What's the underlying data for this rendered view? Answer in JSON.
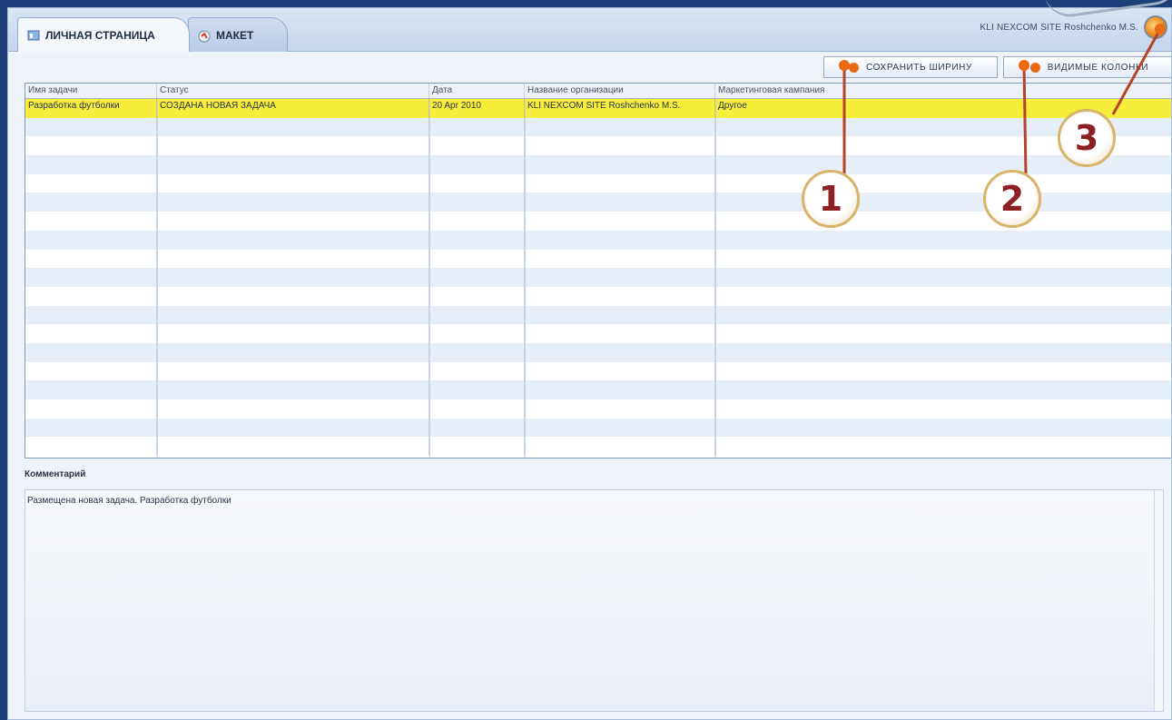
{
  "tabs": [
    {
      "label": "ЛИЧНАЯ СТРАНИЦА",
      "active": true
    },
    {
      "label": "МАКЕТ",
      "active": false
    }
  ],
  "header": {
    "user_label": "KLI NEXCOM SITE Roshchenko M.S."
  },
  "toolbar": {
    "save_width_label": "СОХРАНИТЬ ШИРИНУ",
    "visible_columns_label": "ВИДИМЫЕ КОЛОНКИ"
  },
  "table": {
    "columns": [
      "Имя задачи",
      "Статус",
      "Дата",
      "Название организации",
      "Маркетинговая кампания"
    ],
    "rows": [
      [
        "Разработка футболки",
        "СОЗДАНА НОВАЯ ЗАДАЧА",
        "20 Apr 2010",
        "KLI NEXCOM SITE Roshchenko M.S.",
        "Другое"
      ]
    ],
    "empty_rows": 18
  },
  "comment": {
    "label": "Комментарий",
    "text": "Размещена новая задача. Разработка футболки"
  },
  "callouts": [
    "1",
    "2",
    "3"
  ],
  "colors": {
    "selected_row": "#f7ee3c",
    "accent_dot": "#ea6a13",
    "callout_number": "#8e2025",
    "pointer_line": "#b5432a"
  }
}
